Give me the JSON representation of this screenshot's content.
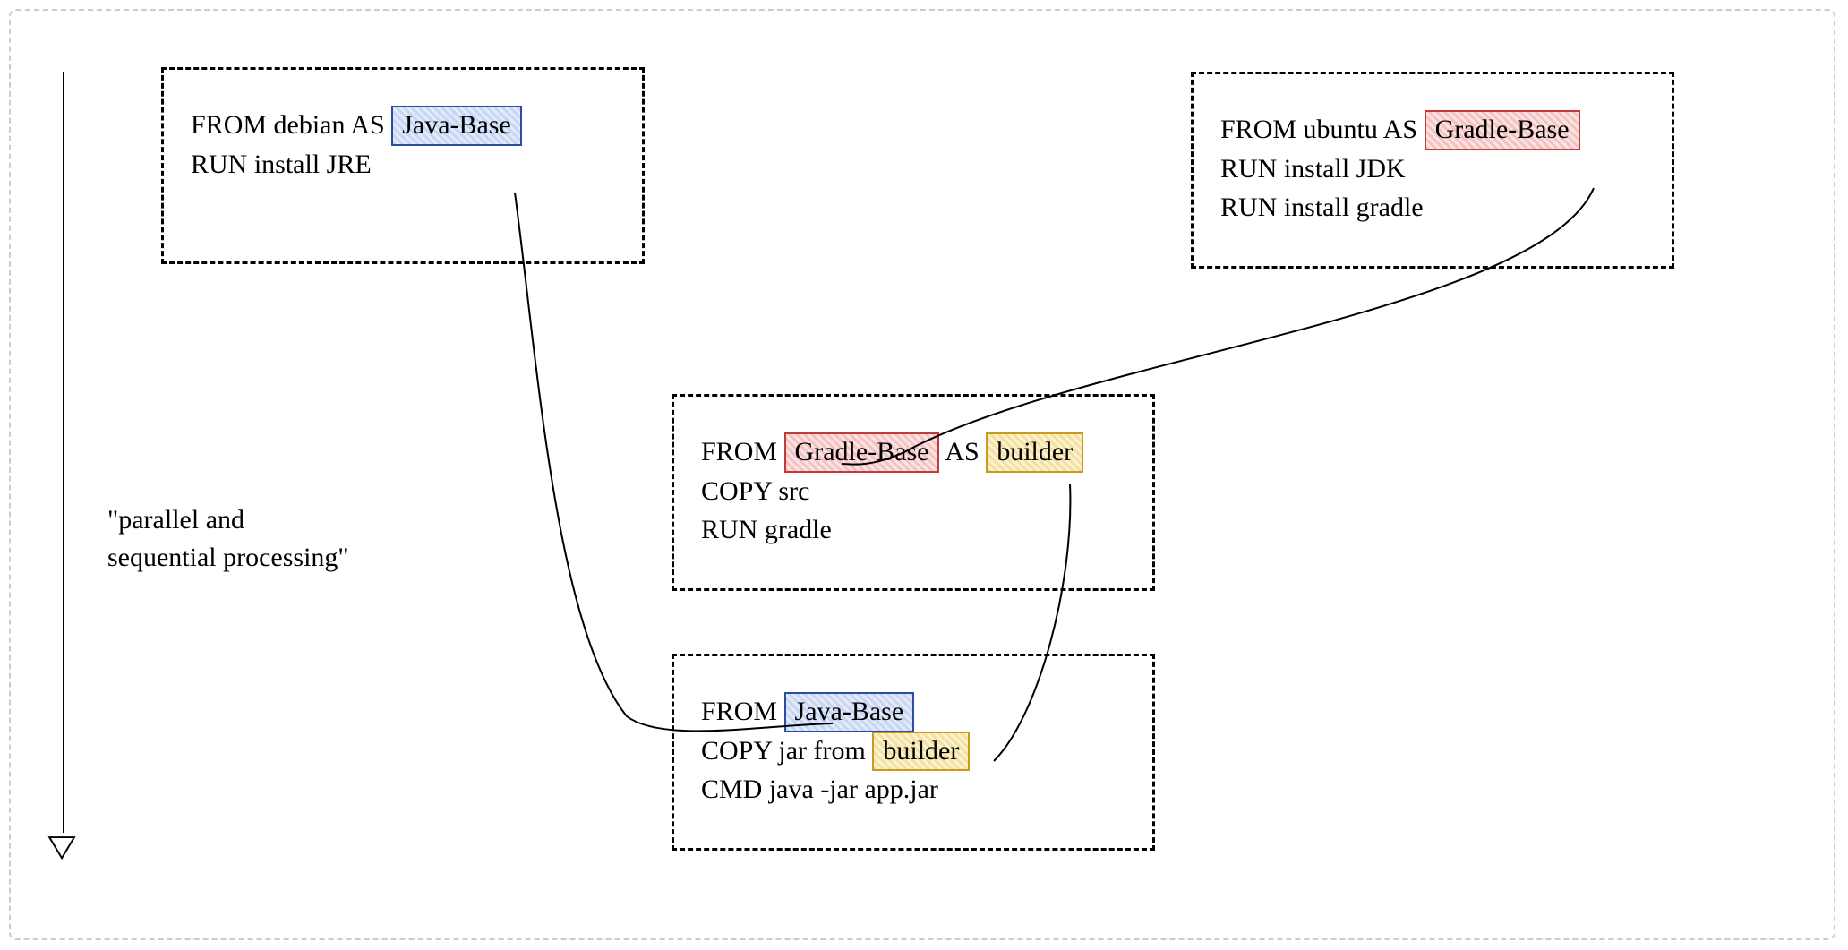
{
  "caption": "\"parallel and\nsequential processing\"",
  "stages": {
    "javaBase": {
      "line1_prefix": "FROM debian AS ",
      "line1_hl": "Java-Base",
      "line2": "RUN install JRE"
    },
    "gradleBase": {
      "line1_prefix": "FROM ubuntu AS ",
      "line1_hl": "Gradle-Base",
      "line2": "RUN install JDK",
      "line3": "RUN install gradle"
    },
    "builder": {
      "line1_prefix": "FROM ",
      "line1_hl1": "Gradle-Base",
      "line1_mid": " AS ",
      "line1_hl2": "builder",
      "line2": "COPY src",
      "line3": "RUN gradle"
    },
    "final": {
      "line1_prefix": "FROM ",
      "line1_hl": "Java-Base",
      "line2_prefix": "COPY jar from ",
      "line2_hl": "builder",
      "line3": "CMD java -jar app.jar"
    }
  },
  "colors": {
    "javaBase": "blue",
    "gradleBase": "red",
    "builder": "yellow"
  }
}
